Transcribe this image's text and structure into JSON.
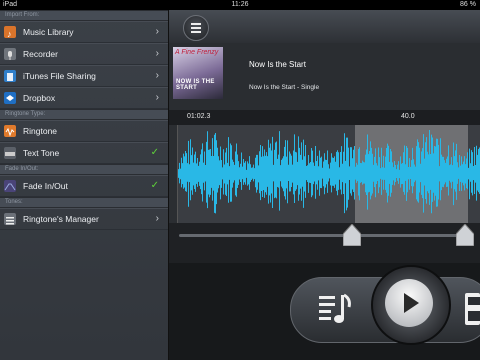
{
  "status_bar": {
    "device": "iPad",
    "time": "11:26",
    "battery": "86 %"
  },
  "sidebar": {
    "sections": [
      {
        "header": "Import From:",
        "items": [
          {
            "label": "Music Library",
            "icon": "music-library-icon",
            "accessory": "chevron"
          },
          {
            "label": "Recorder",
            "icon": "recorder-icon",
            "accessory": "chevron"
          },
          {
            "label": "iTunes File Sharing",
            "icon": "itunes-file-sharing-icon",
            "accessory": "chevron"
          },
          {
            "label": "Dropbox",
            "icon": "dropbox-icon",
            "accessory": "chevron"
          }
        ]
      },
      {
        "header": "Ringtone Type:",
        "items": [
          {
            "label": "Ringtone",
            "icon": "ringtone-icon",
            "accessory": "none"
          },
          {
            "label": "Text Tone",
            "icon": "text-tone-icon",
            "accessory": "check"
          }
        ]
      },
      {
        "header": "Fade In/Out:",
        "items": [
          {
            "label": "Fade In/Out",
            "icon": "fade-icon",
            "accessory": "check"
          }
        ]
      },
      {
        "header": "Tones:",
        "items": [
          {
            "label": "Ringtone's Manager",
            "icon": "ringtones-manager-icon",
            "accessory": "chevron"
          }
        ]
      }
    ]
  },
  "track": {
    "title": "Now Is the Start",
    "album": "Now Is the Start - Single",
    "artwork_text_top": "A Fine Frenzy",
    "artwork_text_bottom": "NOW IS THE START"
  },
  "timeline": {
    "start": "01:02.3",
    "end": "40.0"
  },
  "colors": {
    "waveform": "#29b8e6",
    "selection": "#a8a8a8",
    "check": "#5ed13a"
  }
}
